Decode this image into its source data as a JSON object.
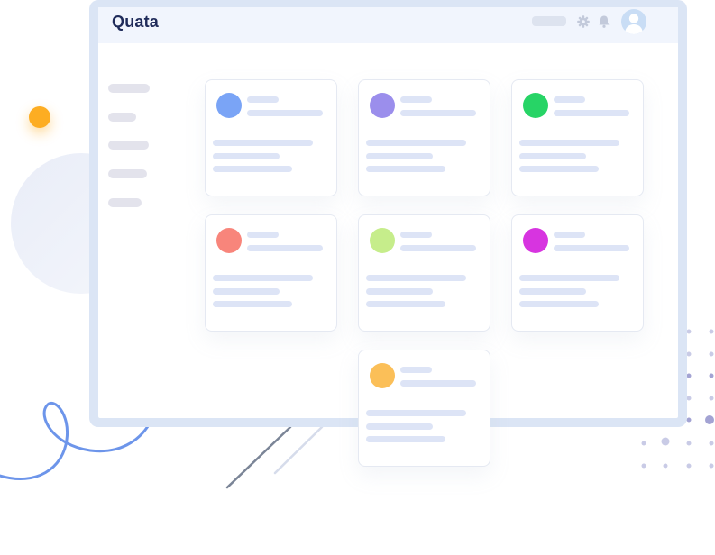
{
  "app": {
    "brand": "Quata"
  },
  "header": {
    "settings_icon": "gear-icon",
    "notifications_icon": "bell-icon",
    "profile_icon": "user-avatar-icon"
  },
  "sidebar": {
    "items": [
      {
        "label": ""
      },
      {
        "label": ""
      },
      {
        "label": ""
      },
      {
        "label": ""
      },
      {
        "label": ""
      }
    ]
  },
  "cards": [
    {
      "avatar_color": "#7aa4f6"
    },
    {
      "avatar_color": "#9b8eec"
    },
    {
      "avatar_color": "#27d466"
    },
    {
      "avatar_color": "#f8857b"
    },
    {
      "avatar_color": "#c6ed8b"
    },
    {
      "avatar_color": "#d734e0"
    },
    {
      "avatar_color": "#fbbf58"
    }
  ],
  "colors": {
    "monitor_frame": "#dbe5f5",
    "topbar": "#f1f5fd",
    "skeleton_line": "#dde4f6",
    "accent_blue": "#6d95ea",
    "accent_orange": "#fdad22"
  }
}
